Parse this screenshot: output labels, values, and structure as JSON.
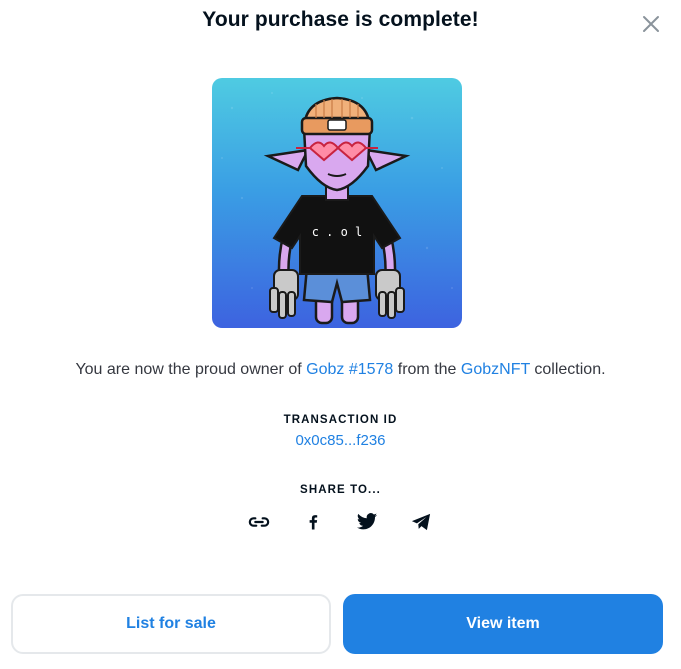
{
  "modal": {
    "title": "Your purchase is complete!",
    "close_icon": "close-icon"
  },
  "nft": {
    "image_alt": "Gobz #1578",
    "shirt_text": "c.o.l"
  },
  "owner": {
    "prefix": "You are now the proud owner of ",
    "item_name": "Gobz #1578",
    "middle": " from the ",
    "collection_name": "GobzNFT",
    "suffix": " collection."
  },
  "transaction": {
    "label": "TRANSACTION ID",
    "value": "0x0c85...f236"
  },
  "share": {
    "label": "SHARE TO...",
    "icons": [
      "link-icon",
      "facebook-icon",
      "twitter-icon",
      "telegram-icon"
    ]
  },
  "actions": {
    "list_label": "List for sale",
    "view_label": "View item"
  },
  "colors": {
    "accent": "#2081e2",
    "text": "#04111d"
  }
}
